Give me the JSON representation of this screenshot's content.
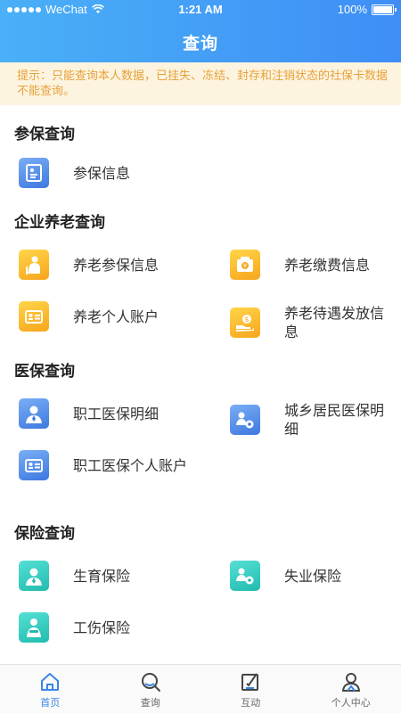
{
  "status_bar": {
    "carrier": "WeChat",
    "time": "1:21 AM",
    "battery": "100%"
  },
  "header": {
    "title": "查询"
  },
  "notice": {
    "text": "提示：只能查询本人数据，已挂失、冻结、封存和注销状态的社保卡数据不能查询。"
  },
  "sections": [
    {
      "title": "参保查询",
      "items": [
        {
          "label": "参保信息",
          "icon": "document-card-icon"
        }
      ]
    },
    {
      "title": "企业养老查询",
      "items": [
        {
          "label": "养老参保信息",
          "icon": "elderly-person-icon"
        },
        {
          "label": "养老缴费信息",
          "icon": "payment-box-icon"
        },
        {
          "label": "养老个人账户",
          "icon": "id-card-icon"
        },
        {
          "label": "养老待遇发放信息",
          "icon": "hand-money-icon"
        }
      ]
    },
    {
      "title": "医保查询",
      "items": [
        {
          "label": "职工医保明细",
          "icon": "worker-icon"
        },
        {
          "label": "城乡居民医保明细",
          "icon": "people-settings-icon"
        },
        {
          "label": "职工医保个人账户",
          "icon": "id-card-icon"
        }
      ]
    },
    {
      "title": "保险查询",
      "items": [
        {
          "label": "生育保险",
          "icon": "person-icon"
        },
        {
          "label": "失业保险",
          "icon": "people-settings-icon"
        },
        {
          "label": "工伤保险",
          "icon": "injured-person-icon"
        }
      ]
    }
  ],
  "tabbar": [
    {
      "label": "首页",
      "icon": "home-icon",
      "active": true
    },
    {
      "label": "查询",
      "icon": "search-icon",
      "active": false
    },
    {
      "label": "互动",
      "icon": "edit-icon",
      "active": false
    },
    {
      "label": "个人中心",
      "icon": "user-icon",
      "active": false
    }
  ],
  "colors": {
    "header": "#3e8ef6",
    "notice_bg": "#fdf4e0",
    "notice_text": "#e8a13a",
    "icon_blue": "#4a86e8",
    "icon_yellow": "#f9b52c",
    "icon_teal": "#2cc7b9",
    "tab_active": "#3a86e6"
  }
}
